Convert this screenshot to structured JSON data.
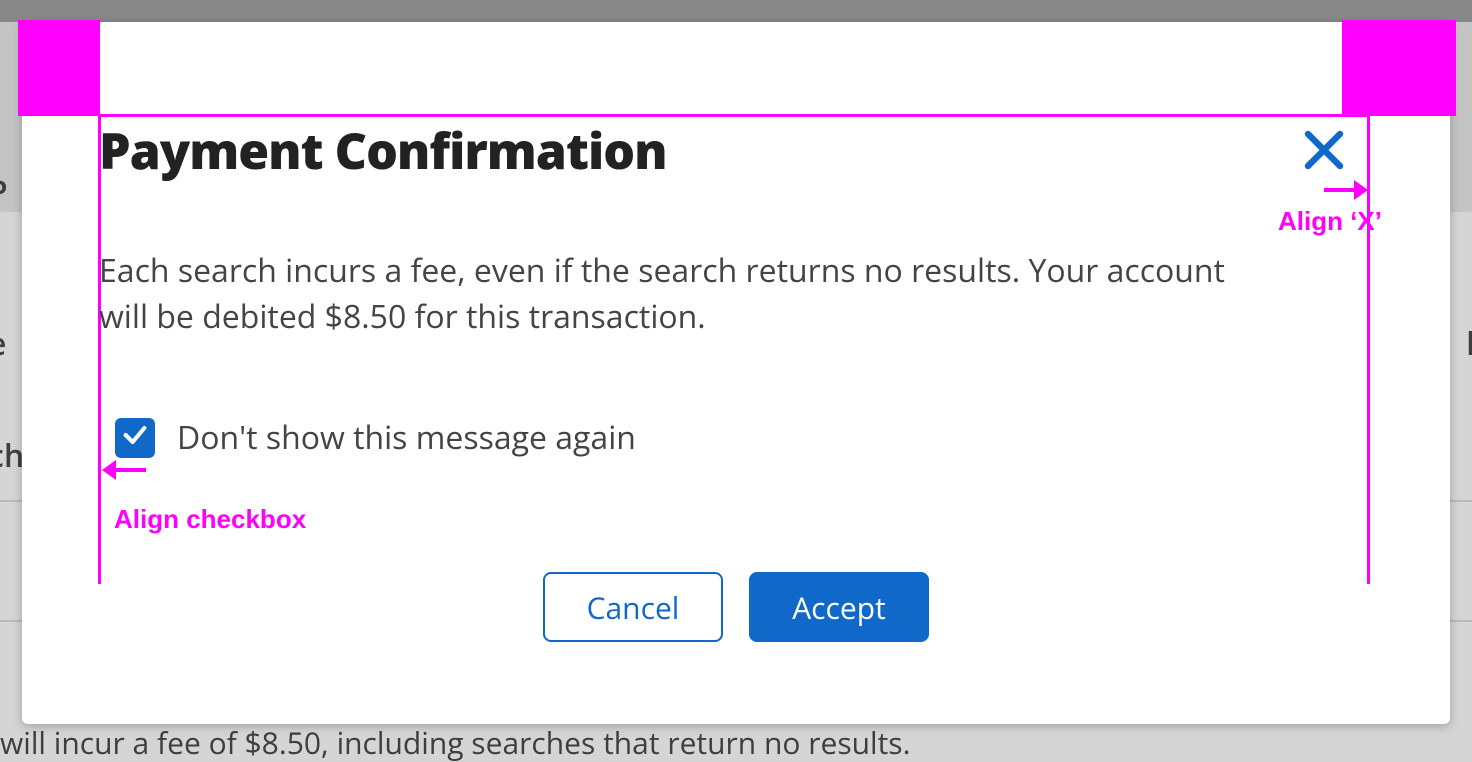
{
  "background": {
    "edge_left_1": "P",
    "edge_left_2": "e",
    "edge_left_3": "ch",
    "edge_right_1": "li",
    "fee_line": "will incur a fee of $8.50, including searches that return no results."
  },
  "modal": {
    "title": "Payment Confirmation",
    "body": "Each search incurs a fee, even if the search returns no results. Your account will be debited $8.50 for this transaction.",
    "checkbox_label": "Don't show this message again",
    "checkbox_checked": true,
    "buttons": {
      "cancel": "Cancel",
      "accept": "Accept"
    }
  },
  "annotations": {
    "align_x": "Align ‘X’",
    "align_checkbox": "Align checkbox"
  },
  "colors": {
    "annotation": "#ff00ff",
    "primary": "#1068c9"
  }
}
